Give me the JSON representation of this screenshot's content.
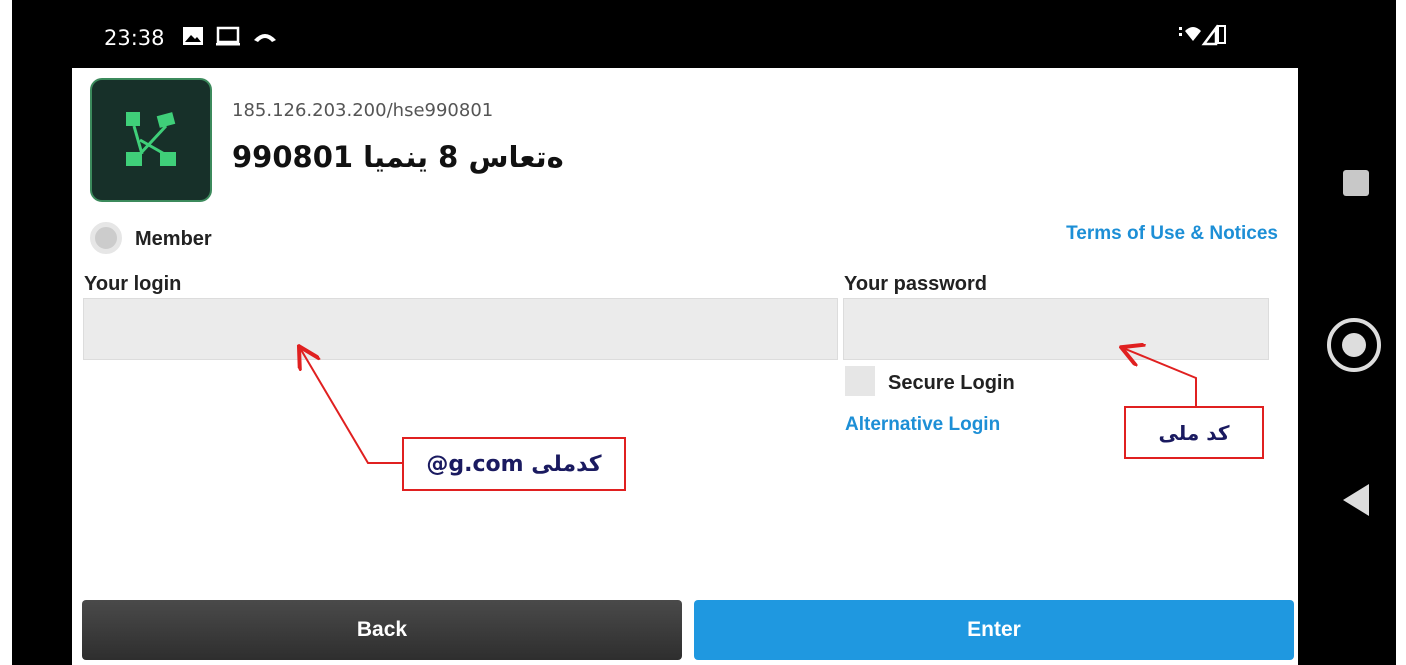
{
  "status_bar": {
    "time": "23:38",
    "left_icons": [
      "image-icon",
      "cast-icon",
      "phone-hangup-icon"
    ],
    "right_icons": [
      "vibrate-icon",
      "wifi-icon",
      "signal-icon",
      "battery-icon"
    ]
  },
  "app": {
    "logo_icon": "adobe-connect-logo-icon",
    "url": "185.126.203.200/hse990801",
    "meeting_title": "990801 ەتعاس 8 ینمیا"
  },
  "form": {
    "member_label": "Member",
    "terms_link": "Terms of Use & Notices",
    "login_label": "Your login",
    "login_value": "",
    "password_label": "Your password",
    "password_value": "",
    "secure_login_label": "Secure Login",
    "alternative_login": "Alternative Login"
  },
  "buttons": {
    "back": "Back",
    "enter": "Enter"
  },
  "annotations": {
    "login_note": "@g.com کدملی",
    "password_note": "کد ملی"
  },
  "nav_bar": {
    "icons": [
      "recents-icon",
      "home-icon",
      "back-icon"
    ]
  },
  "colors": {
    "link": "#1d8fd6",
    "enter_button": "#1f98e0",
    "back_button": "#3a3a3a",
    "annotation_border": "#e02020"
  }
}
